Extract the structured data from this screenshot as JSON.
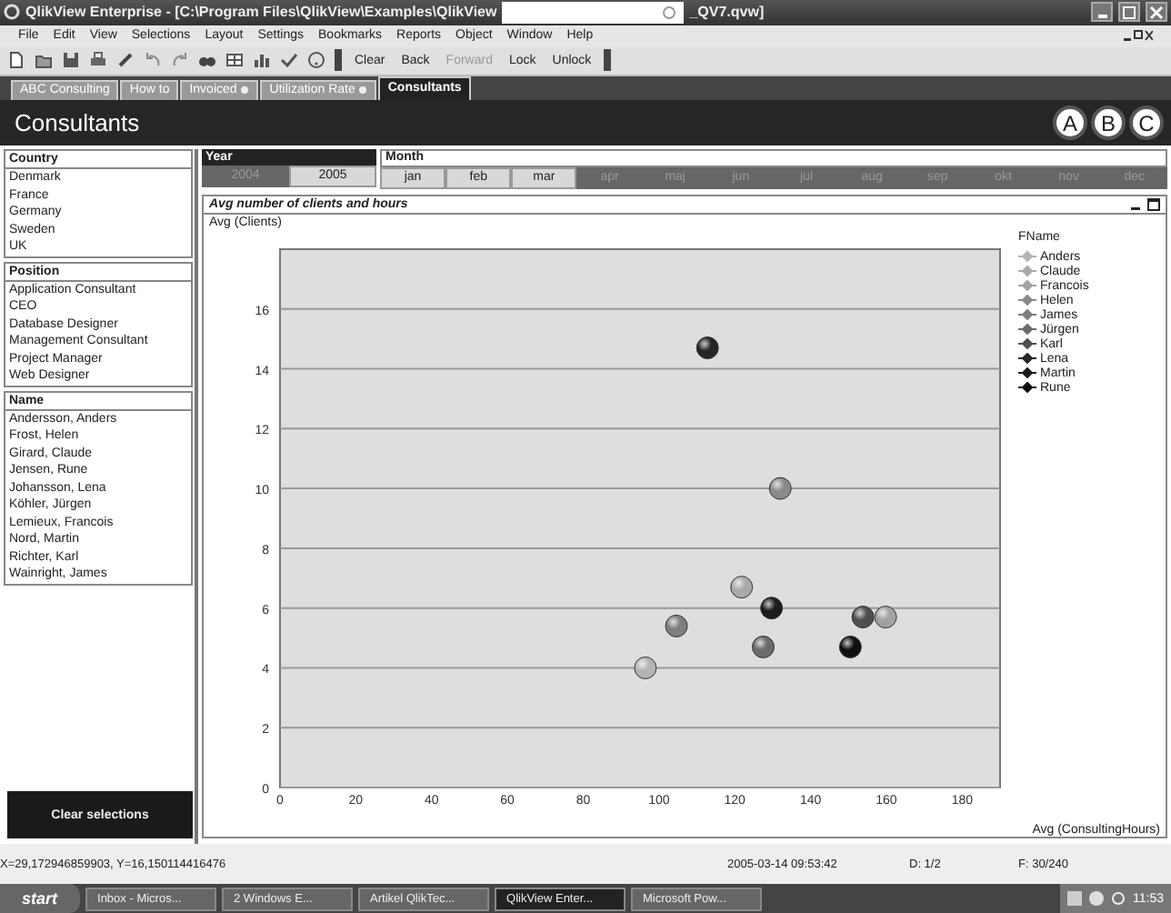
{
  "window": {
    "title": "QlikView Enterprise - [C:\\Program Files\\QlikView\\Examples\\QlikView",
    "title_end": "_QV7.qvw]"
  },
  "menu": [
    "File",
    "Edit",
    "View",
    "Selections",
    "Layout",
    "Settings",
    "Bookmarks",
    "Reports",
    "Object",
    "Window",
    "Help"
  ],
  "toolbar": [
    {
      "label": "Clear",
      "disabled": false
    },
    {
      "label": "Back",
      "disabled": false
    },
    {
      "label": "Forward",
      "disabled": true
    },
    {
      "label": "Lock",
      "disabled": false
    },
    {
      "label": "Unlock",
      "disabled": false
    }
  ],
  "tabs": [
    {
      "label": "ABC Consulting",
      "selected": false,
      "flagged": false
    },
    {
      "label": "How to",
      "selected": false,
      "flagged": false
    },
    {
      "label": "Invoiced",
      "selected": false,
      "flagged": true
    },
    {
      "label": "Utilization Rate",
      "selected": false,
      "flagged": true
    },
    {
      "label": "Consultants",
      "selected": true,
      "flagged": false
    }
  ],
  "sheet": {
    "title": "Consultants",
    "badges": [
      "A",
      "B",
      "C"
    ]
  },
  "listboxes": [
    {
      "title": "Country",
      "items": [
        "Denmark",
        "France",
        "Germany",
        "Sweden",
        "UK"
      ]
    },
    {
      "title": "Position",
      "items": [
        "Application Consultant",
        "CEO",
        "Database Designer",
        "Management Consultant",
        "Project Manager",
        "Web Designer"
      ]
    },
    {
      "title": "Name",
      "items": [
        "Andersson, Anders",
        "Frost, Helen",
        "Girard, Claude",
        "Jensen, Rune",
        "Johansson, Lena",
        "Köhler, Jürgen",
        "Lemieux, Francois",
        "Nord, Martin",
        "Richter, Karl",
        "Wainright, James"
      ]
    }
  ],
  "clear_button": "Clear selections",
  "year": {
    "title": "Year",
    "values": [
      {
        "label": "2004",
        "excluded": true
      },
      {
        "label": "2005",
        "excluded": false
      }
    ]
  },
  "month": {
    "title": "Month",
    "values": [
      {
        "label": "jan",
        "excluded": false
      },
      {
        "label": "feb",
        "excluded": false
      },
      {
        "label": "mar",
        "excluded": false
      },
      {
        "label": "apr",
        "excluded": true
      },
      {
        "label": "maj",
        "excluded": true
      },
      {
        "label": "jun",
        "excluded": true
      },
      {
        "label": "jul",
        "excluded": true
      },
      {
        "label": "aug",
        "excluded": true
      },
      {
        "label": "sep",
        "excluded": true
      },
      {
        "label": "okt",
        "excluded": true
      },
      {
        "label": "nov",
        "excluded": true
      },
      {
        "label": "dec",
        "excluded": true
      }
    ]
  },
  "chart": {
    "legend_title": "FName",
    "chart_data": {
      "type": "scatter",
      "grid": true,
      "title": "Avg number of clients and hours",
      "xlabel": "Avg (ConsultingHours)",
      "ylabel": "Avg (Clients)",
      "xlim": [
        0,
        190
      ],
      "ylim": [
        0,
        18
      ],
      "xticks": [
        0,
        20,
        40,
        60,
        80,
        100,
        120,
        140,
        160,
        180
      ],
      "yticks": [
        0,
        2,
        4,
        6,
        8,
        10,
        12,
        14,
        16
      ],
      "series": [
        {
          "name": "Anders",
          "color": "#b4b4b4",
          "x": [
            96.4
          ],
          "values": [
            4.0
          ]
        },
        {
          "name": "Claude",
          "color": "#aaaaaa",
          "x": [
            121.8
          ],
          "values": [
            6.7
          ]
        },
        {
          "name": "Francois",
          "color": "#a2a2a2",
          "x": [
            159.8
          ],
          "values": [
            5.7
          ]
        },
        {
          "name": "Helen",
          "color": "#8a8a8a",
          "x": [
            132
          ],
          "values": [
            10.0
          ]
        },
        {
          "name": "James",
          "color": "#7e7e7e",
          "x": [
            104.6
          ],
          "values": [
            5.4
          ]
        },
        {
          "name": "Jürgen",
          "color": "#6a6a6a",
          "x": [
            127.5
          ],
          "values": [
            4.7
          ]
        },
        {
          "name": "Karl",
          "color": "#4e4e4e",
          "x": [
            153.8
          ],
          "values": [
            5.7
          ]
        },
        {
          "name": "Lena",
          "color": "#262626",
          "x": [
            112.8
          ],
          "values": [
            14.7
          ]
        },
        {
          "name": "Martin",
          "color": "#1c1c1c",
          "x": [
            129.7
          ],
          "values": [
            6.0
          ]
        },
        {
          "name": "Rune",
          "color": "#111111",
          "x": [
            150.5
          ],
          "values": [
            4.7
          ]
        }
      ]
    }
  },
  "status_bar": {
    "coords": "X=29,172946859903, Y=16,150114416476",
    "time": "2005-03-14 09:53:42",
    "docs": "D: 1/2",
    "fields": "F: 30/240"
  },
  "taskbar": {
    "start": "start",
    "items": [
      {
        "label": "Inbox - Micros...",
        "selected": false
      },
      {
        "label": "2 Windows E...",
        "selected": false
      },
      {
        "label": "Artikel QlikTec...",
        "selected": false
      },
      {
        "label": "QlikView Enter...",
        "selected": true
      },
      {
        "label": "Microsoft Pow...",
        "selected": false
      }
    ],
    "clock": "11:53"
  }
}
